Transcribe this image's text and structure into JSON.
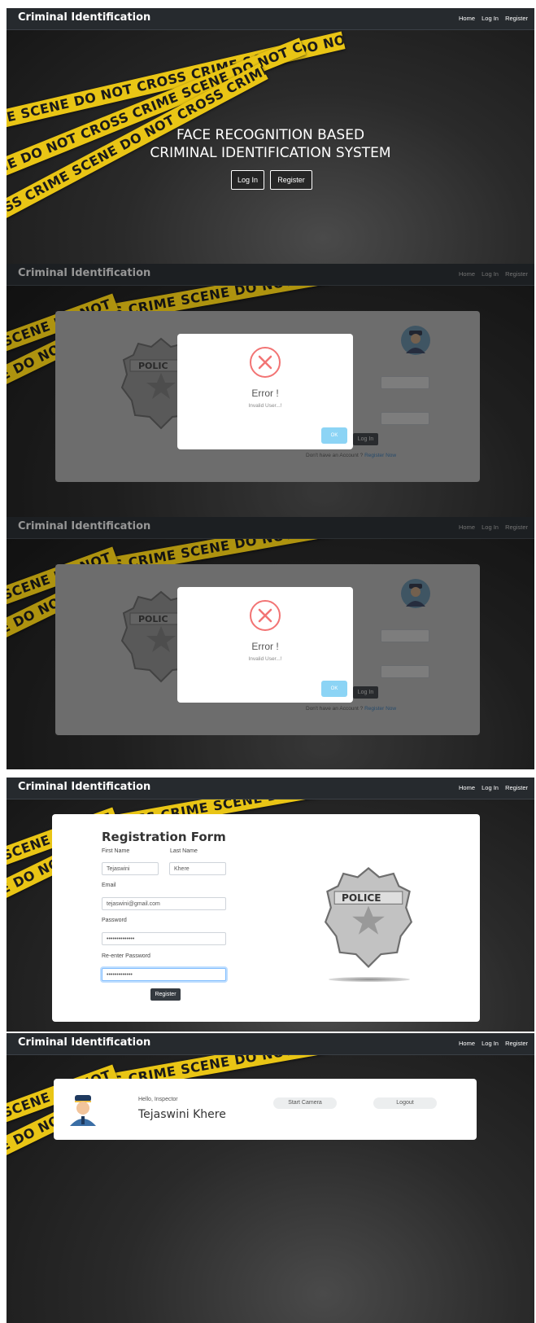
{
  "brand": "Criminal Identification",
  "nav": {
    "home": "Home",
    "login": "Log In",
    "register": "Register"
  },
  "tape": {
    "text_a": "RIME SCENE DO NOT CROSS CRIME SCENE DO NOT",
    "text_b": "SCENE DO NOT CROSS CRIME SCENE DO NOT CROSS",
    "text_c": "CROSS CRIME SCENE DO NOT CROSS CRIME SCENE"
  },
  "hero": {
    "title_line1": "FACE RECOGNITION BASED",
    "title_line2": "CRIMINAL IDENTIFICATION SYSTEM",
    "login_label": "Log In",
    "register_label": "Register"
  },
  "login_error": {
    "badge_text": "POLIC",
    "error_title": "Error !",
    "error_text": "Invalid User...!",
    "ok_label": "OK",
    "login_button": "Log In",
    "no_account": "Don't have an Account ?",
    "register_now": "Register Now"
  },
  "registration": {
    "title": "Registration Form",
    "first_name_label": "First Name",
    "last_name_label": "Last Name",
    "first_name_value": "Tejaswini",
    "last_name_value": "Khere",
    "email_label": "Email",
    "email_value": "tejaswini@gmail.com",
    "password_label": "Password",
    "password_value": "••••••••••••••",
    "reenter_label": "Re-enter Password",
    "reenter_value": "•••••••••••••",
    "register_button": "Register",
    "badge_text": "POLICE"
  },
  "dashboard": {
    "greeting": "Hello, Inspector",
    "name": "Tejaswini Khere",
    "start_camera": "Start Camera",
    "logout": "Logout"
  },
  "colors": {
    "tape": "#e9c515",
    "nav": "#262a2e",
    "error": "#f27474",
    "ok": "#8cd4f5",
    "link": "#3085d6"
  }
}
